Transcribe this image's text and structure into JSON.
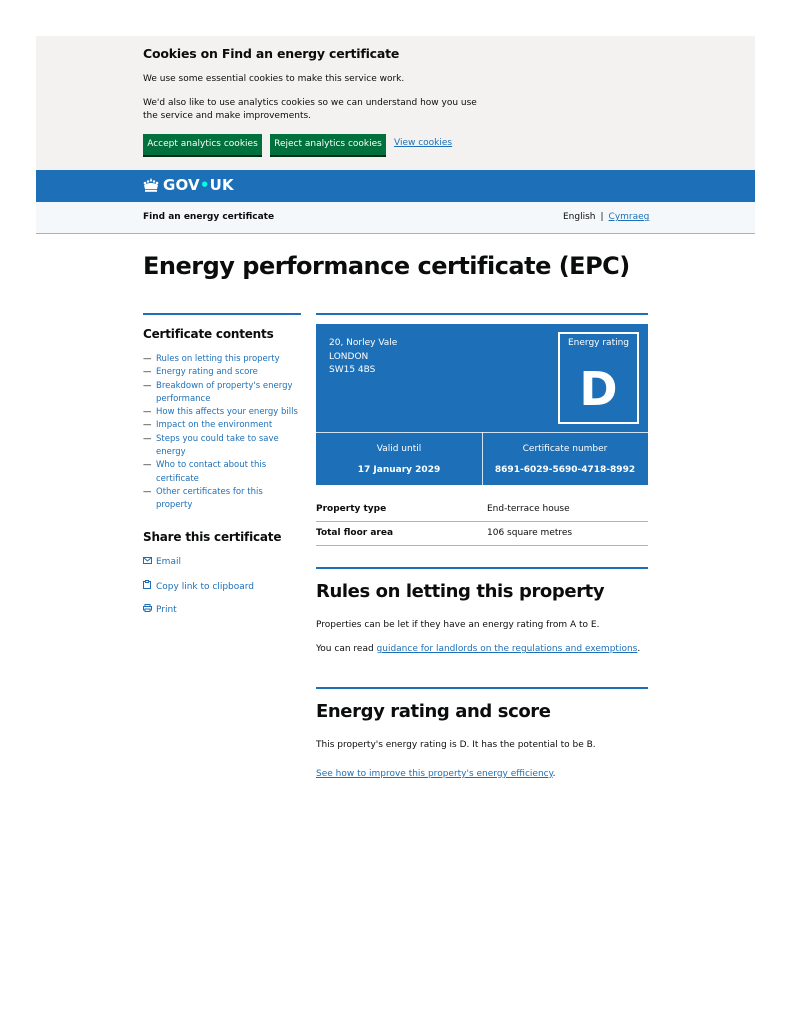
{
  "cookie_banner": {
    "heading": "Cookies on Find an energy certificate",
    "text1": "We use some essential cookies to make this service work.",
    "text2": "We'd also like to use analytics cookies so we can understand how you use the service and make improvements.",
    "accept_label": "Accept analytics cookies",
    "reject_label": "Reject analytics cookies",
    "view_label": "View cookies"
  },
  "header": {
    "logo_text_gov": "GOV",
    "logo_dot": "•",
    "logo_text_uk": "UK",
    "service_name": "Find an energy certificate",
    "lang_current": "English",
    "lang_separator": "|",
    "lang_other": "Cymraeg"
  },
  "page_title": "Energy performance certificate (EPC)",
  "sidebar": {
    "contents_heading": "Certificate contents",
    "items": [
      "Rules on letting this property",
      "Energy rating and score",
      "Breakdown of property's energy performance",
      "How this affects your energy bills",
      "Impact on the environment",
      "Steps you could take to save energy",
      "Who to contact about this certificate",
      "Other certificates for this property"
    ],
    "share_heading": "Share this certificate",
    "share_email": "Email",
    "share_copy": "Copy link to clipboard",
    "share_print": "Print"
  },
  "certificate": {
    "address_line1": "20, Norley Vale",
    "address_line2": "LONDON",
    "address_line3": "SW15 4BS",
    "rating_label": "Energy rating",
    "rating": "D",
    "valid_until_label": "Valid until",
    "valid_until": "17 January 2029",
    "cert_number_label": "Certificate number",
    "cert_number": "8691-6029-5690-4718-8992",
    "colors": {
      "card_bg": "#1d70b8",
      "button_green": "#00703c"
    }
  },
  "property": {
    "type_label": "Property type",
    "type_value": "End-terrace house",
    "area_label": "Total floor area",
    "area_value": "106 square metres"
  },
  "letting": {
    "heading": "Rules on letting this property",
    "text": "Properties can be let if they have an energy rating from A to E.",
    "read_prefix": "You can read ",
    "read_link": "guidance for landlords on the regulations and exemptions",
    "read_suffix": "."
  },
  "rating_section": {
    "heading": "Energy rating and score",
    "text": "This property's energy rating is D. It has the potential to be B.",
    "improve_link": "See how to improve this property's energy efficiency",
    "improve_suffix": "."
  }
}
